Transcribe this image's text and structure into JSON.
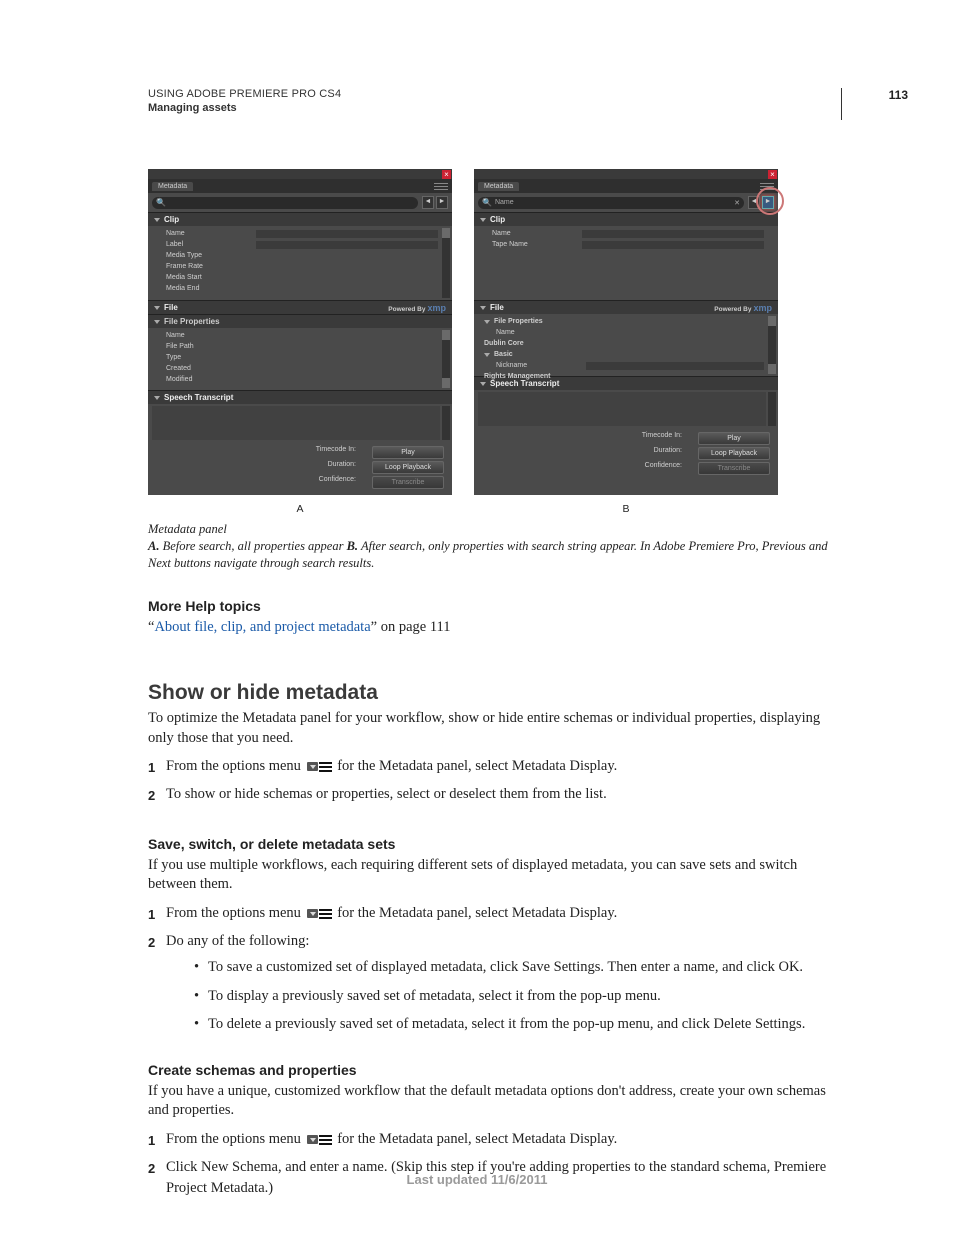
{
  "header": {
    "line1": "USING ADOBE PREMIERE PRO CS4",
    "line2": "Managing assets",
    "page_number": "113"
  },
  "figure": {
    "panel_tab": "Metadata",
    "close": "×",
    "search_placeholder_b": "Name",
    "nav_prev": "◄",
    "nav_next": "►",
    "powered_by": "Powered By",
    "powered_brand": "xmp",
    "panel_a": {
      "clip_section": "Clip",
      "clip_rows": [
        "Name",
        "Label",
        "Media Type",
        "Frame Rate",
        "Media Start",
        "Media End"
      ],
      "file_section": "File",
      "file_props": "File Properties",
      "file_rows": [
        "Name",
        "File Path",
        "Type",
        "Created",
        "Modified"
      ],
      "transcript_section": "Speech Transcript"
    },
    "panel_b": {
      "clip_section": "Clip",
      "clip_rows": [
        "Name",
        "Tape Name"
      ],
      "file_section": "File",
      "file_props": "File Properties",
      "file_rows": [
        "Name"
      ],
      "dublin": "Dublin Core",
      "basic": "Basic",
      "basic_rows": [
        "Nickname"
      ],
      "rights": "Rights Management",
      "transcript_section": "Speech Transcript"
    },
    "bottom": {
      "timecode": "Timecode In:",
      "duration": "Duration:",
      "confidence": "Confidence:",
      "play": "Play",
      "loop": "Loop Playback",
      "transcribe": "Transcribe"
    },
    "label_a": "A",
    "label_b": "B",
    "caption_title": "Metadata panel",
    "caption_a_label": "A.",
    "caption_a": " Before search, all properties appear   ",
    "caption_b_label": "B.",
    "caption_b": " After search, only properties with search string appear. In Adobe Premiere Pro, Previous and Next buttons navigate through search results."
  },
  "more_help": {
    "heading": "More Help topics",
    "quote_open": "“",
    "link": "About file, clip, and project metadata",
    "quote_close": "” on page 111"
  },
  "section1": {
    "heading": "Show or hide metadata",
    "intro": "To optimize the Metadata panel for your workflow, show or hide entire schemas or individual properties, displaying only those that you need.",
    "step1a": "From the options menu ",
    "step1b": " for the Metadata panel, select Metadata Display.",
    "step2": "To show or hide schemas or properties, select or deselect them from the list."
  },
  "section2": {
    "heading": "Save, switch, or delete metadata sets",
    "intro": "If you use multiple workflows, each requiring different sets of displayed metadata, you can save sets and switch between them.",
    "step1a": "From the options menu ",
    "step1b": " for the Metadata panel, select Metadata Display.",
    "step2": "Do any of the following:",
    "bullets": [
      "To save a customized set of displayed metadata, click Save Settings. Then enter a name, and click OK.",
      "To display a previously saved set of metadata, select it from the pop-up menu.",
      "To delete a previously saved set of metadata, select it from the pop-up menu, and click Delete Settings."
    ]
  },
  "section3": {
    "heading": "Create schemas and properties",
    "intro": "If you have a unique, customized workflow that the default metadata options don't address, create your own schemas and properties.",
    "step1a": "From the options menu ",
    "step1b": " for the Metadata panel, select Metadata Display.",
    "step2": "Click New Schema, and enter a name. (Skip this step if you're adding properties to the standard schema, Premiere Project Metadata.)"
  },
  "footer": "Last updated 11/6/2011"
}
